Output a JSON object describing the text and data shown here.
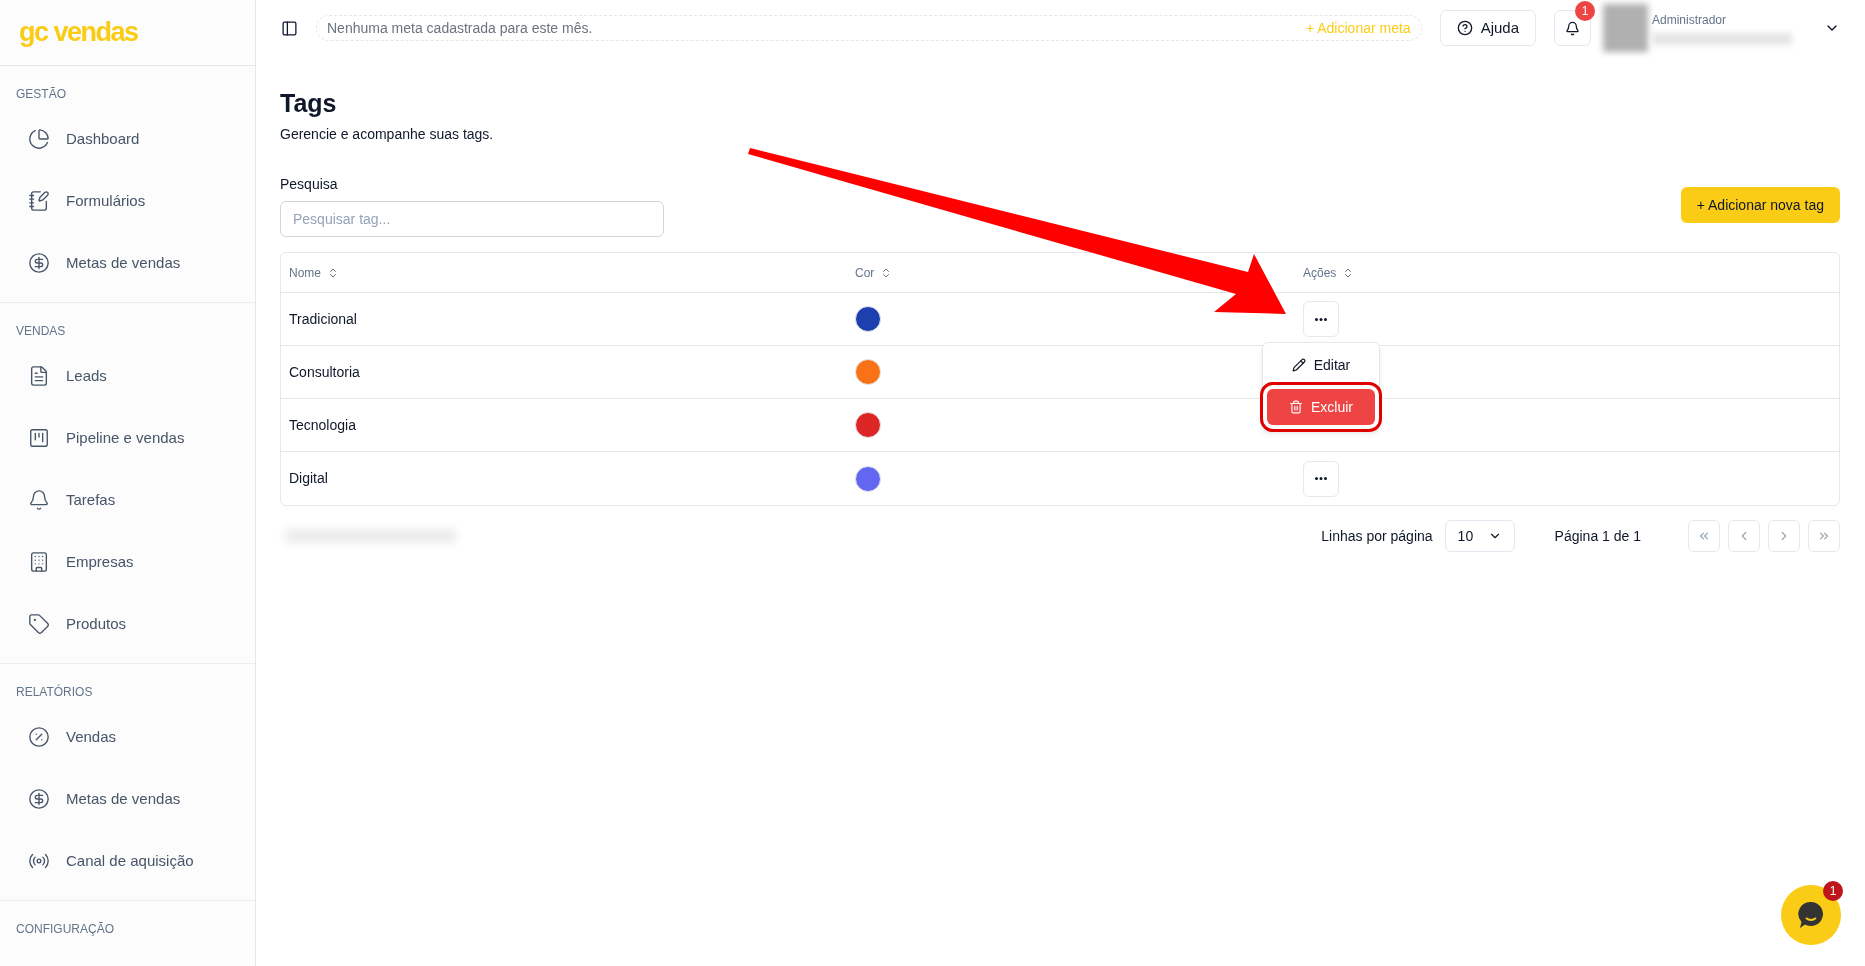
{
  "brand": "gc vendas",
  "sidebar": {
    "sections": [
      {
        "title": "GESTÃO",
        "items": [
          {
            "label": "Dashboard"
          },
          {
            "label": "Formulários"
          },
          {
            "label": "Metas de vendas"
          }
        ]
      },
      {
        "title": "VENDAS",
        "items": [
          {
            "label": "Leads"
          },
          {
            "label": "Pipeline e vendas"
          },
          {
            "label": "Tarefas"
          },
          {
            "label": "Empresas"
          },
          {
            "label": "Produtos"
          }
        ]
      },
      {
        "title": "RELATÓRIOS",
        "items": [
          {
            "label": "Vendas"
          },
          {
            "label": "Metas de vendas"
          },
          {
            "label": "Canal de aquisição"
          }
        ]
      },
      {
        "title": "CONFIGURAÇÃO"
      }
    ]
  },
  "header": {
    "goal_text": "Nenhuma meta cadastrada para este mês.",
    "add_goal": "+ Adicionar meta",
    "help": "Ajuda",
    "notification_count": "1",
    "user_role": "Administrador"
  },
  "page": {
    "title": "Tags",
    "subtitle": "Gerencie e acompanhe suas tags."
  },
  "search": {
    "label": "Pesquisa",
    "placeholder": "Pesquisar tag..."
  },
  "add_button": "+ Adicionar nova tag",
  "table": {
    "columns": [
      "Nome",
      "Cor",
      "Ações"
    ],
    "rows": [
      {
        "name": "Tradicional",
        "color": "#1e40af",
        "button_visible": true
      },
      {
        "name": "Consultoria",
        "color": "#f97316",
        "button_visible": false
      },
      {
        "name": "Tecnologia",
        "color": "#dc2626",
        "button_visible": false
      },
      {
        "name": "Digital",
        "color": "#6366f1",
        "button_visible": true
      }
    ]
  },
  "menu": {
    "items": [
      {
        "label": "Editar",
        "kind": "edit",
        "highlighted": false
      },
      {
        "label": "Excluir",
        "kind": "delete",
        "highlighted": true
      }
    ]
  },
  "pagination": {
    "rows_label": "Linhas por página",
    "rows_value": "10",
    "page_text": "Página 1 de 1"
  },
  "chat": {
    "badge": "1"
  }
}
